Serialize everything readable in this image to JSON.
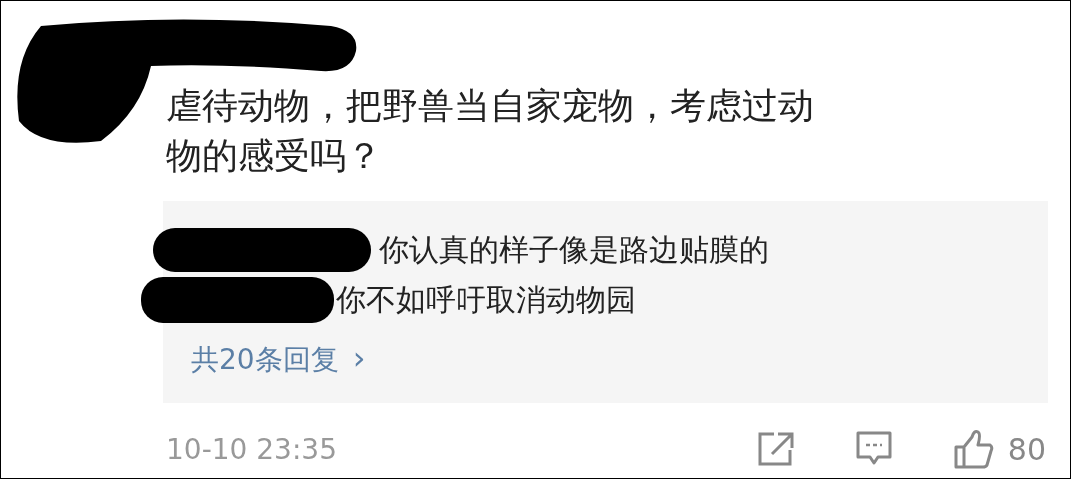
{
  "comment": {
    "text": "虐待动物，把野兽当自家宠物，考虑过动物的感受吗？",
    "time": "10-10 23:35",
    "likes": "80"
  },
  "replies": [
    {
      "text": "你认真的样子像是路边贴膜的"
    },
    {
      "text": "你不如呼吁取消动物园"
    }
  ],
  "more_replies": {
    "label": "共20条回复",
    "arrow": "›"
  }
}
